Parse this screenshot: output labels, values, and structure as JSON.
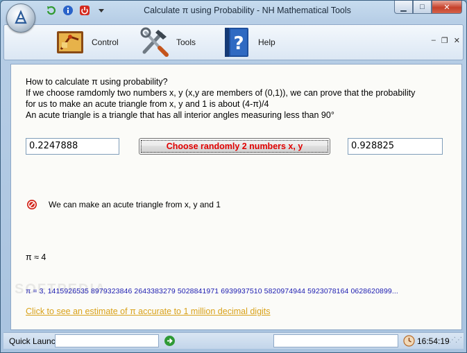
{
  "window": {
    "title": "Calculate π using Probability - NH Mathematical Tools",
    "controls": {
      "minimize": "▁",
      "maximize": "□",
      "close": "✕"
    }
  },
  "quick_access": [
    {
      "name": "refresh-icon"
    },
    {
      "name": "info-icon"
    },
    {
      "name": "power-icon"
    },
    {
      "name": "dropdown-icon"
    }
  ],
  "ribbon": {
    "items": [
      {
        "label": "Control",
        "icon": "control-panel-icon"
      },
      {
        "label": "Tools",
        "icon": "tools-icon"
      },
      {
        "label": "Help",
        "icon": "help-book-icon"
      }
    ],
    "mini_controls": {
      "min": "–",
      "restore": "❐",
      "close": "✕"
    }
  },
  "content": {
    "description": [
      "How to calculate π using probability?",
      "If we choose ramdomly two numbers x, y (x,y are members of (0,1)), we can prove that the probability",
      "for us to make an acute triangle from x, y and 1 is about (4-π)/4",
      "An acute triangle is a triangle that has all interior angles measuring less than 90°"
    ],
    "x_value": "0.2247888",
    "y_value": "0.928825",
    "choose_button_label": "Choose randomly 2 numbers x, y",
    "result_text": "We can make an acute triangle from x, y and 1",
    "pi_approx": "π ≈ 4",
    "pi_digits": "π = 3, 1415926535 8979323846 2643383279 5028841971 6939937510 5820974944 5923078164 0628620899...",
    "link_text": "Click to see an estimate of π accurate to 1 million decimal digits",
    "watermark": "SOFTPEDIA"
  },
  "statusbar": {
    "quick_launch_label": "Quick Launch",
    "quick_launch_value": "",
    "status_value": "",
    "time": "16:54:19"
  },
  "colors": {
    "button_text": "#e00000",
    "pi_digits": "#1a1ab0",
    "link": "#d9a21a"
  }
}
